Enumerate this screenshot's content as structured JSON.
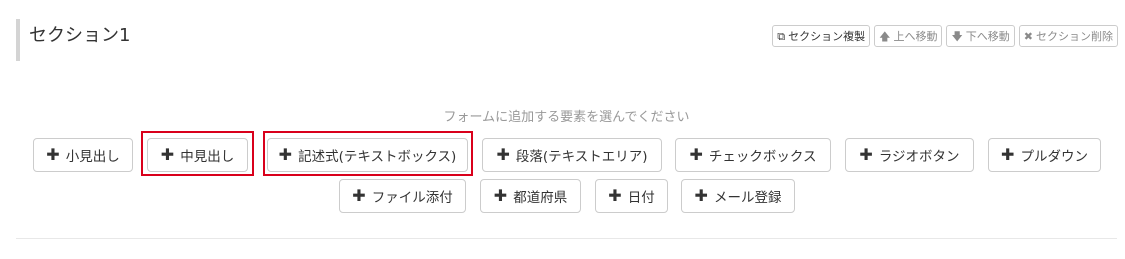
{
  "section": {
    "title": "セクション1"
  },
  "section_tools": [
    {
      "icon": "copy-icon",
      "glyph": "⧉",
      "label": "セクション複製"
    },
    {
      "icon": "arrow-up-icon",
      "glyph": "🡅",
      "label": "上へ移動"
    },
    {
      "icon": "arrow-down-icon",
      "glyph": "🡇",
      "label": "下へ移動"
    },
    {
      "icon": "close-icon",
      "glyph": "✖",
      "label": "セクション削除"
    }
  ],
  "add_prompt": "フォームに追加する要素を選んでください",
  "add_elements": [
    {
      "plus": "✚",
      "label": "小見出し"
    },
    {
      "plus": "✚",
      "label": "中見出し"
    },
    {
      "plus": "✚",
      "label": "記述式(テキストボックス)"
    },
    {
      "plus": "✚",
      "label": "段落(テキストエリア)"
    },
    {
      "plus": "✚",
      "label": "チェックボックス"
    },
    {
      "plus": "✚",
      "label": "ラジオボタン"
    },
    {
      "plus": "✚",
      "label": "プルダウン"
    },
    {
      "plus": "✚",
      "label": "ファイル添付"
    },
    {
      "plus": "✚",
      "label": "都道府県"
    },
    {
      "plus": "✚",
      "label": "日付"
    },
    {
      "plus": "✚",
      "label": "メール登録"
    }
  ],
  "colors": {
    "highlight": "#d9001b",
    "prompt_text": "#999999",
    "section_bar": "#d4d4d4"
  }
}
